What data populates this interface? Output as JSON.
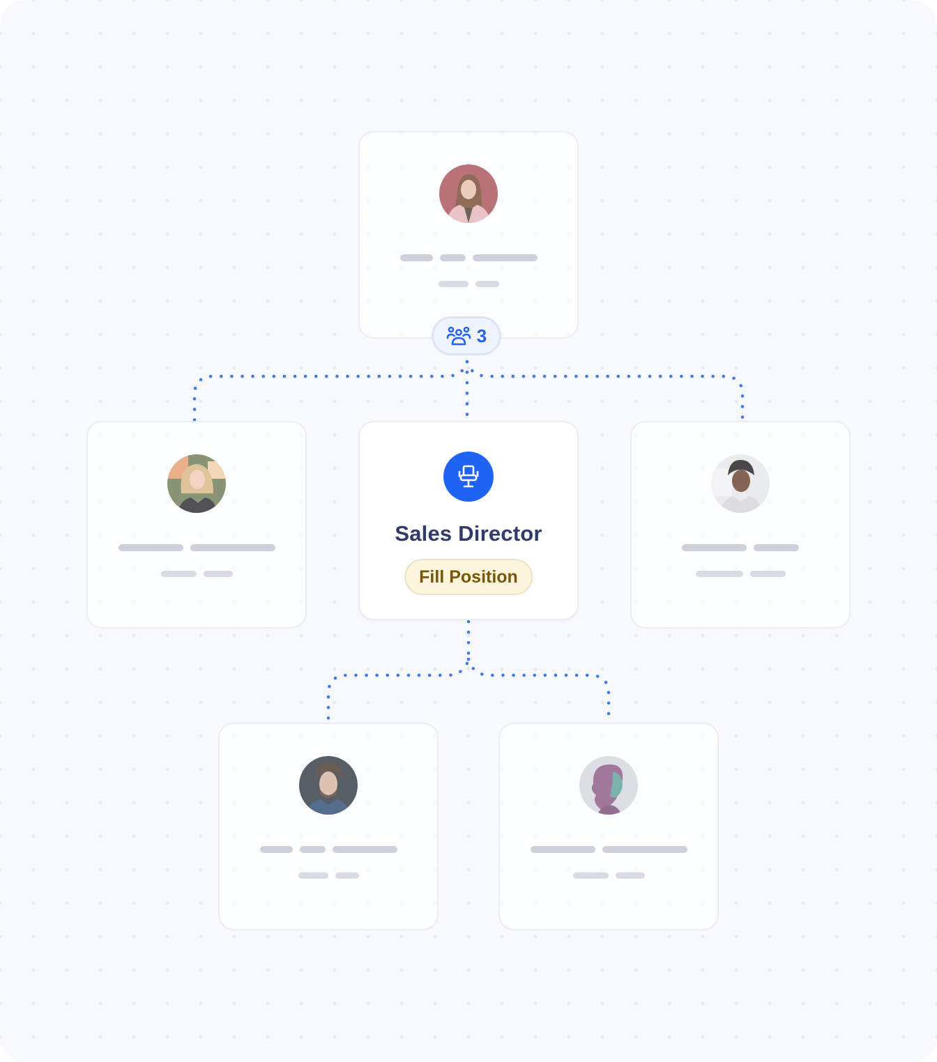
{
  "diagram": {
    "type": "org-chart",
    "link_color": "#3b7af0",
    "root": {
      "id": "root",
      "kind": "person",
      "avatar": "avatar-woman-pink-blazer",
      "skeleton_line1": [
        3,
        2,
        4
      ],
      "skeleton_line2": [
        2,
        1.5
      ],
      "reports_badge": {
        "icon": "team-icon",
        "count": "3"
      }
    },
    "level2": [
      {
        "id": "left",
        "kind": "person",
        "avatar": "avatar-woman-blonde-outdoor"
      },
      {
        "id": "center",
        "kind": "open-position",
        "icon": "office-chair-icon",
        "title": "Sales Director",
        "action_label": "Fill Position"
      },
      {
        "id": "right",
        "kind": "person",
        "avatar": "avatar-woman-short-hair-smiling"
      }
    ],
    "level3": [
      {
        "id": "bottom-left",
        "kind": "person",
        "avatar": "avatar-man-beard-dark-bg",
        "parent": "center"
      },
      {
        "id": "bottom-right",
        "kind": "person",
        "avatar": "avatar-woman-profile-duotone",
        "parent": "center"
      }
    ],
    "colors": {
      "accent": "#1f63f5",
      "title": "#313b6b",
      "action_bg": "#fef5dd",
      "action_text": "#7a5508",
      "badge_bg": "#eef3fe",
      "badge_text": "#2563eb",
      "skeleton": "#cfd0dc",
      "background": "#f8f9fe"
    }
  }
}
